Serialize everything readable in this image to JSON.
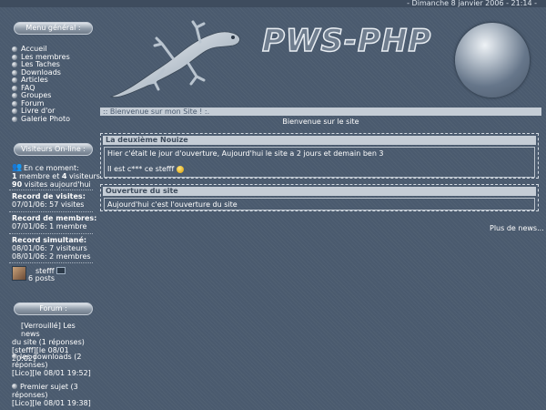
{
  "topbar": {
    "date": "- Dimanche 8 janvier 2006 - 21:14 -"
  },
  "sidebar": {
    "menu_title": "Menu général :",
    "menu_items": [
      "Accueil",
      "Les membres",
      "Les Taches",
      "Downloads",
      "Articles",
      "FAQ",
      "Groupes",
      "Forum",
      "Livre d'or",
      "Galerie Photo"
    ],
    "visitors_title": "Visiteurs On-line :",
    "online": {
      "now_label": "En ce moment:",
      "members_count": "1",
      "members_text": " membre et ",
      "visitors_count": "4",
      "visitors_text": " visiteurs",
      "today_count": "90",
      "today_text": " visites aujourd'hui"
    },
    "records": {
      "visits_label": "Record de visites:",
      "visits_value": "07/01/06: 57 visites",
      "members_label": "Record de membres:",
      "members_value": "07/01/06: 1 membre",
      "simult_label": "Record simultané:",
      "simult_line1": "08/01/06: 7 visiteurs",
      "simult_line2": "08/01/06: 2 membres"
    },
    "user": {
      "name": "stefff",
      "posts": "6 posts"
    },
    "forum_title": "Forum :",
    "forum_items": [
      {
        "line1": "[Verrouillé] Les news",
        "line2": "du site (1 réponses)",
        "line3": "[stefff][le 08/01 20:02]"
      },
      {
        "line1": "les downloads (2",
        "line2": "réponses)",
        "line3": "[Lico][le 08/01 19:52]"
      },
      {
        "line1": "Premier sujet (3",
        "line2": "réponses)",
        "line3": "[Lico][le 08/01 19:38]"
      }
    ]
  },
  "header": {
    "logo_text": "PWS-PHP"
  },
  "content": {
    "welcome_bar": ":: Bienvenue sur mon Site ! :.",
    "welcome_text": "Bienvenue sur le site",
    "news": [
      {
        "title": "La deuxième Nouize",
        "line1": "Hier c'était le jour d'ouverture, Aujourd'hui le site a 2 jours et demain ben 3",
        "line2": "Il est c*** ce stefff"
      },
      {
        "title": "Ouverture du site",
        "line1": "Aujourd'hui c'est l'ouverture du site"
      }
    ],
    "more_news": "Plus de news..."
  }
}
